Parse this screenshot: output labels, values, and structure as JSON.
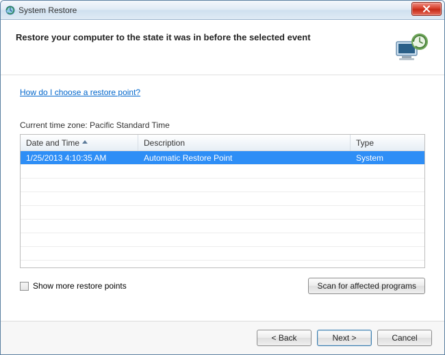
{
  "window": {
    "title": "System Restore"
  },
  "header": {
    "heading": "Restore your computer to the state it was in before the selected event"
  },
  "help_link": "How do I choose a restore point?",
  "timezone_label": "Current time zone: Pacific Standard Time",
  "table": {
    "columns": {
      "date": "Date and Time",
      "desc": "Description",
      "type": "Type"
    },
    "rows": [
      {
        "date": "1/25/2013 4:10:35 AM",
        "desc": "Automatic Restore Point",
        "type": "System",
        "selected": true
      }
    ]
  },
  "show_more": {
    "label": "Show more restore points",
    "checked": false
  },
  "scan_button": "Scan for affected programs",
  "footer": {
    "back": "< Back",
    "next": "Next >",
    "cancel": "Cancel"
  }
}
